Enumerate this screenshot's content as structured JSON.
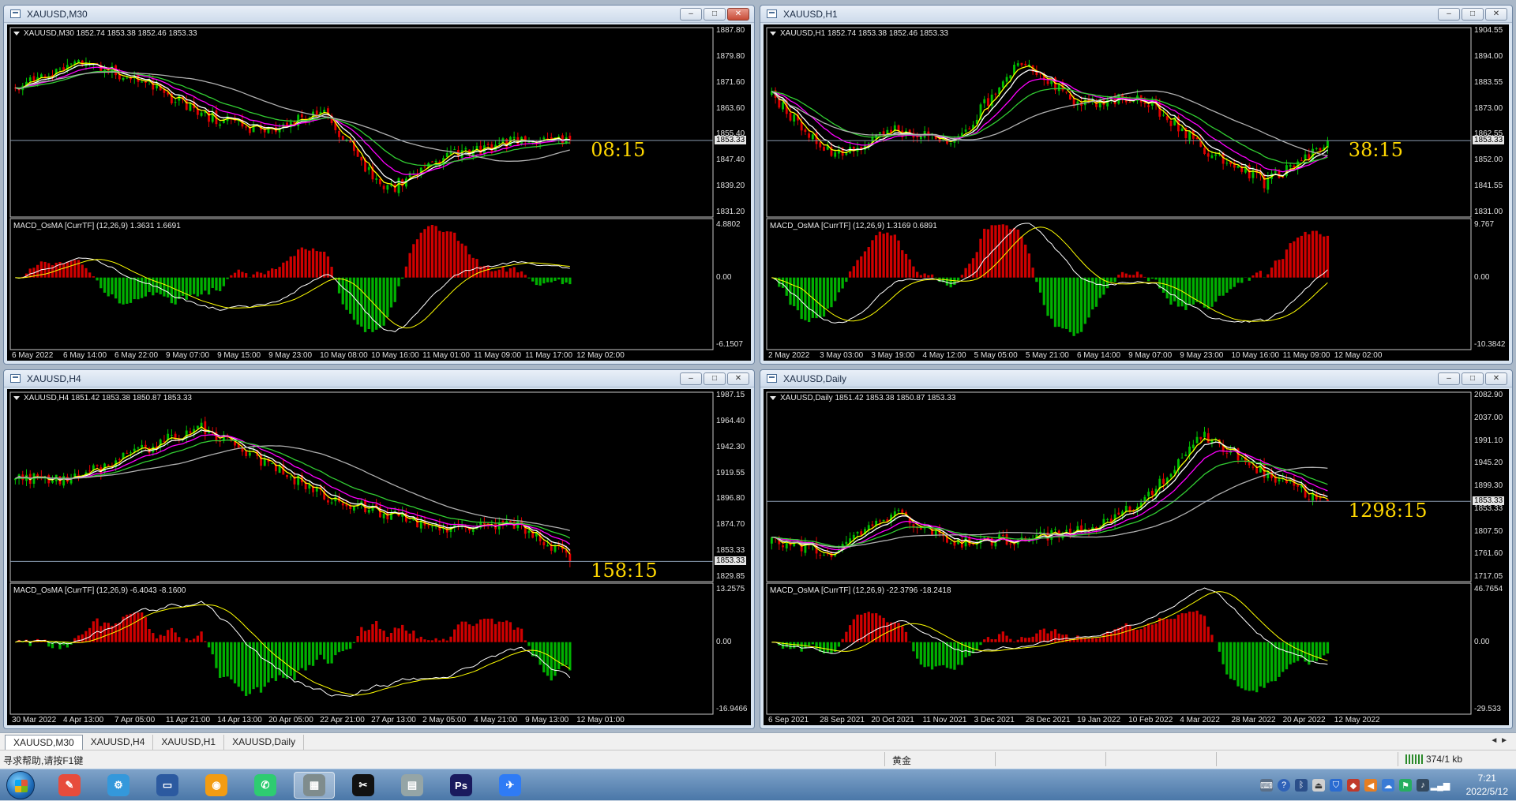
{
  "windows": [
    {
      "id": "m30",
      "title": "XAUUSD,M30",
      "info": "XAUUSD,M30  1852.74 1853.38 1852.46 1853.33",
      "macd_info": "MACD_OsMA [CurrTF] (12,26,9) 1.3631 1.6691",
      "price_labels": [
        "1887.80",
        "1879.80",
        "1871.60",
        "1863.60",
        "1855.40",
        "1847.40",
        "1839.20",
        "1831.20"
      ],
      "current_price": "1853.33",
      "macd_labels": [
        "4.8802",
        "0.00",
        "-6.1507"
      ],
      "time_labels": [
        "6 May 2022",
        "6 May 14:00",
        "6 May 22:00",
        "9 May 07:00",
        "9 May 15:00",
        "9 May 23:00",
        "10 May 08:00",
        "10 May 16:00",
        "11 May 01:00",
        "11 May 09:00",
        "11 May 17:00",
        "12 May 02:00"
      ],
      "countdown": "08:15",
      "seed": 11,
      "shape": [
        0.3,
        0.15,
        0.25,
        0.45,
        0.55,
        0.45,
        0.9,
        0.7,
        0.62,
        0.6
      ],
      "close_active": true
    },
    {
      "id": "h1",
      "title": "XAUUSD,H1",
      "info": "XAUUSD,H1  1852.74 1853.38 1852.46 1853.33",
      "macd_info": "MACD_OsMA [CurrTF] (12,26,9) 1.3169 0.6891",
      "price_labels": [
        "1904.55",
        "1894.00",
        "1883.55",
        "1873.00",
        "1862.55",
        "1852.00",
        "1841.55",
        "1831.00"
      ],
      "current_price": "1853.33",
      "macd_labels": [
        "9.767",
        "0.00",
        "-10.3842"
      ],
      "time_labels": [
        "2 May 2022",
        "3 May 03:00",
        "3 May 19:00",
        "4 May 12:00",
        "5 May 05:00",
        "5 May 21:00",
        "6 May 14:00",
        "9 May 07:00",
        "9 May 23:00",
        "10 May 16:00",
        "11 May 09:00",
        "12 May 02:00"
      ],
      "countdown": "38:15",
      "seed": 23,
      "shape": [
        0.35,
        0.7,
        0.55,
        0.6,
        0.15,
        0.4,
        0.35,
        0.65,
        0.85,
        0.62
      ],
      "close_active": false
    },
    {
      "id": "h4",
      "title": "XAUUSD,H4",
      "info": "XAUUSD,H4  1851.42 1853.38 1850.87 1853.33",
      "macd_info": "MACD_OsMA [CurrTF] (12,26,9) -6.4043 -8.1600",
      "price_labels": [
        "1987.15",
        "1964.40",
        "1942.30",
        "1919.55",
        "1896.80",
        "1874.70",
        "1853.33",
        "1829.85"
      ],
      "current_price": "1853.33",
      "macd_labels": [
        "13.2575",
        "0.00",
        "-16.9466"
      ],
      "time_labels": [
        "30 Mar 2022",
        "4 Apr 13:00",
        "7 Apr 05:00",
        "11 Apr 21:00",
        "14 Apr 13:00",
        "20 Apr 05:00",
        "22 Apr 21:00",
        "27 Apr 13:00",
        "2 May 05:00",
        "4 May 21:00",
        "9 May 13:00",
        "12 May 01:00"
      ],
      "countdown": "158:15",
      "seed": 37,
      "shape": [
        0.45,
        0.45,
        0.3,
        0.15,
        0.35,
        0.55,
        0.65,
        0.75,
        0.7,
        0.9
      ],
      "close_active": false
    },
    {
      "id": "d1",
      "title": "XAUUSD,Daily",
      "info": "XAUUSD,Daily  1851.42 1853.38 1850.87 1853.33",
      "macd_info": "MACD_OsMA [CurrTF] (12,26,9) -22.3796 -18.2418",
      "price_labels": [
        "2082.90",
        "2037.00",
        "1991.10",
        "1945.20",
        "1899.30",
        "1853.33",
        "1807.50",
        "1761.60",
        "1717.05"
      ],
      "current_price": "1853.33",
      "macd_labels": [
        "46.7654",
        "0.00",
        "-29.533"
      ],
      "time_labels": [
        "6 Sep 2021",
        "28 Sep 2021",
        "20 Oct 2021",
        "11 Nov 2021",
        "3 Dec 2021",
        "28 Dec 2021",
        "19 Jan 2022",
        "10 Feb 2022",
        "4 Mar 2022",
        "28 Mar 2022",
        "20 Apr 2022",
        "12 May 2022"
      ],
      "countdown": "1298:15",
      "seed": 53,
      "shape": [
        0.82,
        0.88,
        0.65,
        0.82,
        0.8,
        0.75,
        0.6,
        0.2,
        0.42,
        0.6
      ],
      "close_active": false
    }
  ],
  "window_buttons": {
    "minimize": "‒",
    "maximize": "□",
    "close": "✕"
  },
  "tabs": [
    "XAUUSD,M30",
    "XAUUSD,H4",
    "XAUUSD,H1",
    "XAUUSD,Daily"
  ],
  "tab_nav": "◄ ►",
  "status": {
    "help": "寻求帮助,请按F1键",
    "profile": "黄金",
    "traffic": "374/1 kb"
  },
  "clock": {
    "time": "7:21",
    "date": "2022/5/12"
  },
  "colors": {
    "bull": "#00c000",
    "bear": "#e00000",
    "ma_yellow": "#ffff00",
    "ma_white": "#ffffff",
    "ma_magenta": "#ff00ff",
    "ma_green": "#32cd32",
    "ma_gray": "#b0b0b0",
    "countdown": "#ffd700"
  },
  "taskbar_icons": [
    "paint-icon",
    "network-icon",
    "monitor-icon",
    "media-icon",
    "wechat-icon",
    "metatrader-icon",
    "capcut-icon",
    "notepad-icon",
    "photoshop-icon",
    "feishu-icon"
  ]
}
